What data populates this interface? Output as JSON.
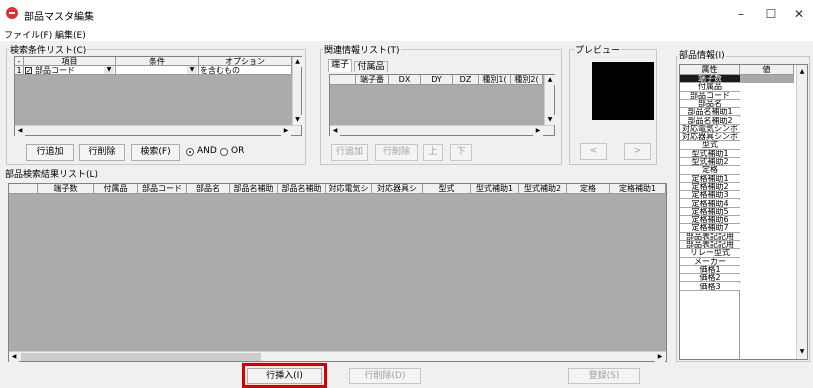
{
  "window": {
    "title": "部品マスタ編集",
    "minimize_label": "–",
    "maximize_label": "☐",
    "close_label": "✕"
  },
  "menu": [
    "ファイル(F)",
    "編集(E)"
  ],
  "search_conditions": {
    "label": "検索条件リスト(C)",
    "columns": [
      "-",
      "項目",
      "条件",
      "オプション"
    ],
    "row": {
      "num": "1",
      "checked": true,
      "item": "部品コード",
      "condition": "",
      "option": "を含むもの"
    }
  },
  "related_info": {
    "label": "関連情報リスト(T)",
    "tabs": [
      "端子",
      "付属品"
    ],
    "columns": [
      "端子番",
      "DX",
      "DY",
      "DZ",
      "種別1(",
      "種別2("
    ]
  },
  "preview": {
    "label": "プレビュー"
  },
  "left_buttons": {
    "add_row": "行追加",
    "delete_row": "行削除",
    "search": "検索(F)",
    "and_label": "AND",
    "or_label": "OR",
    "mode": "AND"
  },
  "related_buttons": {
    "add_row": "行追加",
    "delete_row": "行削除",
    "up": "上",
    "down": "下"
  },
  "preview_buttons": {
    "prev": "<",
    "next": ">"
  },
  "results": {
    "label": "部品検索結果リスト(L)",
    "columns": [
      "端子数",
      "付属品",
      "部品コード",
      "部品名",
      "部品名補助",
      "部品名補助",
      "対応電気シ",
      "対応器具シ",
      "型式",
      "型式補助1",
      "型式補助2",
      "定格",
      "定格補助1"
    ]
  },
  "bottom_buttons": {
    "insert_row": "行挿入(I)",
    "delete_row": "行削除(D)",
    "register": "登録(S)"
  },
  "part_info": {
    "label": "部品情報(I)",
    "columns": [
      "属性",
      "値"
    ],
    "attributes": [
      "端子数",
      "付属品",
      "部品コード",
      "部品名",
      "部品名補助1",
      "部品名補助2",
      "対応電気シンボ",
      "対応器具シンボ",
      "型式",
      "型式補助1",
      "型式補助2",
      "定格",
      "定格補助1",
      "定格補助2",
      "定格補助3",
      "定格補助4",
      "定格補助5",
      "定格補助6",
      "定格補助7",
      "部品表記記用",
      "部品表記記用",
      "リレー型式",
      "メーカー",
      "価格1",
      "価格2",
      "価格3"
    ]
  },
  "colors": {
    "highlight": "#d40000",
    "grid_bg": "#ababab"
  }
}
